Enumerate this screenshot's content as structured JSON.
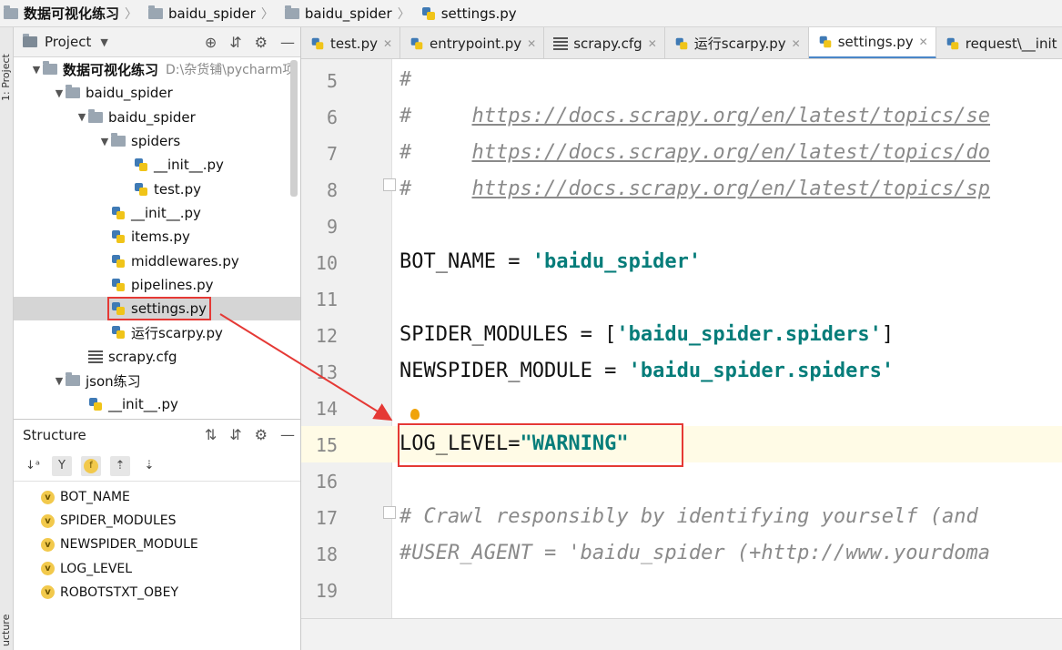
{
  "breadcrumb": [
    {
      "label": "数据可视化练习"
    },
    {
      "label": "baidu_spider"
    },
    {
      "label": "baidu_spider"
    },
    {
      "label": "settings.py"
    }
  ],
  "left_strip": {
    "top_label": "1: Project",
    "bottom_label": "ucture"
  },
  "project_panel": {
    "title": "Project",
    "tree": [
      {
        "label": "数据可视化练习",
        "path": "D:\\杂货铺\\pycharm项",
        "indent": 0,
        "kind": "folder",
        "open": true
      },
      {
        "label": "baidu_spider",
        "indent": 1,
        "kind": "folder",
        "open": true
      },
      {
        "label": "baidu_spider",
        "indent": 2,
        "kind": "folder",
        "open": true
      },
      {
        "label": "spiders",
        "indent": 3,
        "kind": "folder",
        "open": true
      },
      {
        "label": "__init__.py",
        "indent": 4,
        "kind": "py"
      },
      {
        "label": "test.py",
        "indent": 4,
        "kind": "py"
      },
      {
        "label": "__init__.py",
        "indent": 3,
        "kind": "py"
      },
      {
        "label": "items.py",
        "indent": 3,
        "kind": "py"
      },
      {
        "label": "middlewares.py",
        "indent": 3,
        "kind": "py"
      },
      {
        "label": "pipelines.py",
        "indent": 3,
        "kind": "py"
      },
      {
        "label": "settings.py",
        "indent": 3,
        "kind": "py",
        "selected": true
      },
      {
        "label": "运行scarpy.py",
        "indent": 3,
        "kind": "py"
      },
      {
        "label": "scrapy.cfg",
        "indent": 2,
        "kind": "cfg"
      },
      {
        "label": "json练习",
        "indent": 1,
        "kind": "folder",
        "open": true
      },
      {
        "label": "__init__.py",
        "indent": 2,
        "kind": "py"
      }
    ]
  },
  "structure_panel": {
    "title": "Structure",
    "items": [
      "BOT_NAME",
      "SPIDER_MODULES",
      "NEWSPIDER_MODULE",
      "LOG_LEVEL",
      "ROBOTSTXT_OBEY"
    ]
  },
  "tabs": [
    {
      "label": "test.py",
      "icon": "python-file-icon"
    },
    {
      "label": "entrypoint.py",
      "icon": "python-file-icon"
    },
    {
      "label": "scrapy.cfg",
      "icon": "config-file-icon"
    },
    {
      "label": "运行scarpy.py",
      "icon": "python-file-icon"
    },
    {
      "label": "settings.py",
      "icon": "python-file-icon",
      "active": true
    },
    {
      "label": "request\\__init",
      "icon": "python-file-icon"
    }
  ],
  "code": [
    {
      "n": "5",
      "parts": [
        {
          "t": "#",
          "c": "cmt"
        }
      ]
    },
    {
      "n": "6",
      "parts": [
        {
          "t": "#     ",
          "c": "cmt"
        },
        {
          "t": "https://docs.scrapy.org/en/latest/topics/se",
          "c": "url"
        }
      ]
    },
    {
      "n": "7",
      "parts": [
        {
          "t": "#     ",
          "c": "cmt"
        },
        {
          "t": "https://docs.scrapy.org/en/latest/topics/do",
          "c": "url"
        }
      ]
    },
    {
      "n": "8",
      "parts": [
        {
          "t": "#     ",
          "c": "cmt"
        },
        {
          "t": "https://docs.scrapy.org/en/latest/topics/sp",
          "c": "url"
        }
      ]
    },
    {
      "n": "9",
      "parts": []
    },
    {
      "n": "10",
      "parts": [
        {
          "t": "BOT_NAME = ",
          "c": ""
        },
        {
          "t": "'baidu_spider'",
          "c": "str"
        }
      ]
    },
    {
      "n": "11",
      "parts": []
    },
    {
      "n": "12",
      "parts": [
        {
          "t": "SPIDER_MODULES = [",
          "c": ""
        },
        {
          "t": "'baidu_spider.spiders'",
          "c": "str"
        },
        {
          "t": "]",
          "c": ""
        }
      ]
    },
    {
      "n": "13",
      "parts": [
        {
          "t": "NEWSPIDER_MODULE = ",
          "c": ""
        },
        {
          "t": "'baidu_spider.spiders'",
          "c": "str"
        }
      ]
    },
    {
      "n": "14",
      "parts": []
    },
    {
      "n": "15",
      "parts": [
        {
          "t": "LOG_LEVEL=",
          "c": ""
        },
        {
          "t": "\"WARNING\"",
          "c": "str"
        }
      ]
    },
    {
      "n": "16",
      "parts": []
    },
    {
      "n": "17",
      "parts": [
        {
          "t": "# Crawl responsibly by identifying yourself (and",
          "c": "cmt"
        }
      ]
    },
    {
      "n": "18",
      "parts": [
        {
          "t": "#USER_AGENT = 'baidu_spider (+http://www.yourdoma",
          "c": "cmt"
        }
      ]
    },
    {
      "n": "19",
      "parts": []
    }
  ],
  "colors": {
    "highlight": "#e53935",
    "string": "#067d7a",
    "comment": "#8a8a8a"
  }
}
